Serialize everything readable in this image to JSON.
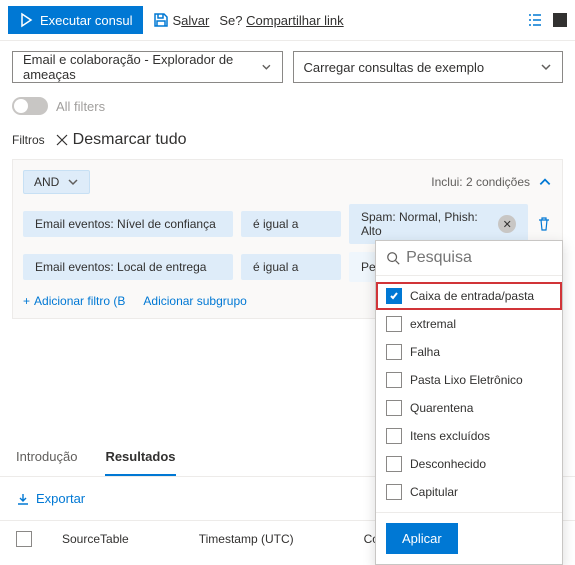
{
  "toolbar": {
    "run": "Executar consul",
    "save_prefix": "S",
    "save_underline": "alvar",
    "share_prefix": "Se?",
    "share_underline": "Compartilhar link"
  },
  "selects": {
    "scope": "Email e colaboração - Explorador de ameaças",
    "load": "Carregar consultas de exemplo"
  },
  "allfilters": "All filters",
  "filters_label": "Filtros",
  "clear_all": "Desmarcar tudo",
  "group": {
    "op": "AND",
    "includes": "Inclui: 2 condições",
    "rows": [
      {
        "field": "Email eventos: Nível de confiança",
        "op": "é igual a",
        "value": "Spam: Normal, Phish: Alto"
      },
      {
        "field": "Email eventos: Local de entrega",
        "op": "é igual a",
        "value": "Pesquisar"
      }
    ],
    "add_filter": "Adicionar filtro (B",
    "add_subgroup": "Adicionar subgrupo"
  },
  "dropdown": {
    "search_placeholder": "Pesquisa",
    "options": [
      {
        "label": "Caixa de entrada/pasta",
        "checked": true,
        "hl": true
      },
      {
        "label": "extremal",
        "checked": false
      },
      {
        "label": "Falha",
        "checked": false
      },
      {
        "label": "Pasta Lixo Eletrônico",
        "checked": false
      },
      {
        "label": "Quarentena",
        "checked": false
      },
      {
        "label": "Itens excluídos",
        "checked": false
      },
      {
        "label": "Desconhecido",
        "checked": false
      },
      {
        "label": "Capitular",
        "checked": false
      }
    ],
    "apply": "Aplicar"
  },
  "tabs": {
    "intro": "Introdução",
    "results": "Resultados"
  },
  "export": "Exportar",
  "columns": {
    "c1": "SourceTable",
    "c2": "Timestamp (UTC)",
    "c3": "Concebid"
  }
}
